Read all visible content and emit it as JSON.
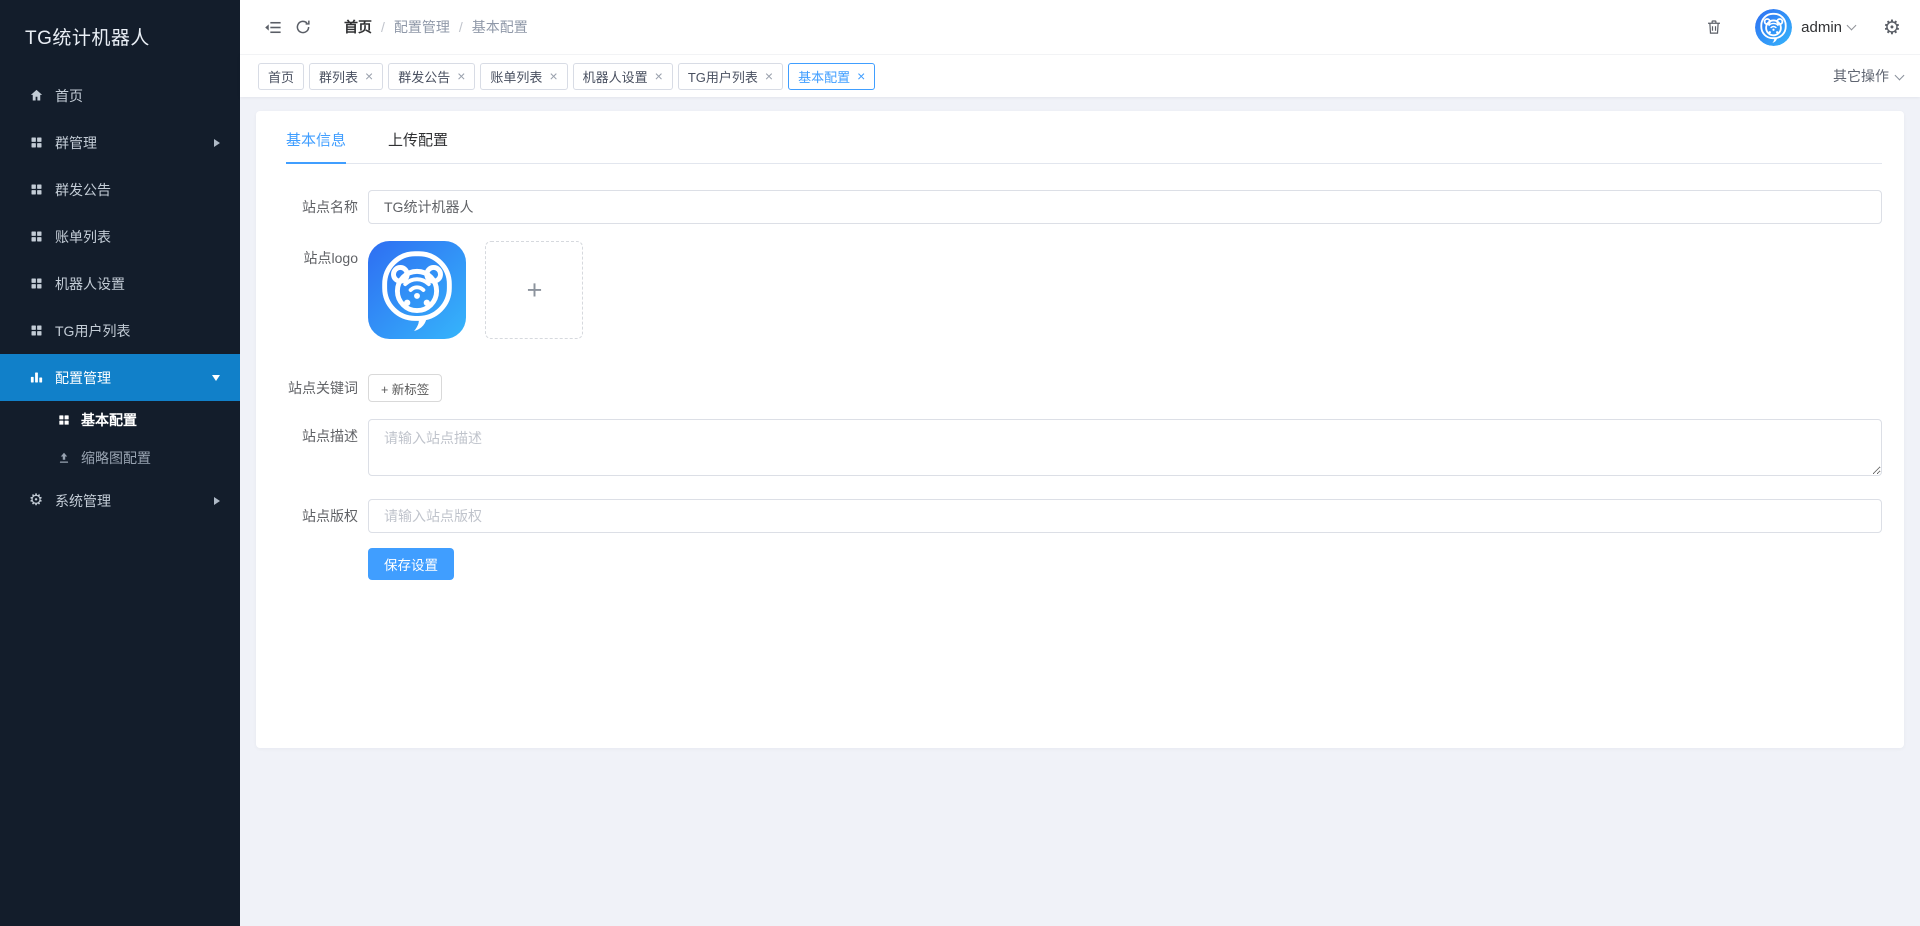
{
  "app": {
    "title": "TG统计机器人"
  },
  "sidebar": {
    "items": [
      {
        "label": "首页"
      },
      {
        "label": "群管理"
      },
      {
        "label": "群发公告"
      },
      {
        "label": "账单列表"
      },
      {
        "label": "机器人设置"
      },
      {
        "label": "TG用户列表"
      },
      {
        "label": "配置管理",
        "children": [
          {
            "label": "基本配置"
          },
          {
            "label": "缩略图配置"
          }
        ]
      },
      {
        "label": "系统管理"
      }
    ]
  },
  "header": {
    "breadcrumb": [
      "首页",
      "配置管理",
      "基本配置"
    ],
    "user": "admin"
  },
  "tags": {
    "items": [
      {
        "label": "首页"
      },
      {
        "label": "群列表"
      },
      {
        "label": "群发公告"
      },
      {
        "label": "账单列表"
      },
      {
        "label": "机器人设置"
      },
      {
        "label": "TG用户列表"
      },
      {
        "label": "基本配置"
      }
    ],
    "more_label": "其它操作"
  },
  "content": {
    "tabs": [
      {
        "label": "基本信息"
      },
      {
        "label": "上传配置"
      }
    ],
    "form": {
      "site_name": {
        "label": "站点名称",
        "value": "TG统计机器人"
      },
      "site_logo": {
        "label": "站点logo"
      },
      "site_keywords": {
        "label": "站点关键词",
        "add_label": "+ 新标签"
      },
      "site_desc": {
        "label": "站点描述",
        "placeholder": "请输入站点描述"
      },
      "site_copyright": {
        "label": "站点版权",
        "placeholder": "请输入站点版权"
      },
      "save_label": "保存设置"
    }
  },
  "icons": {
    "close": "×",
    "plus": "+",
    "separator": "/",
    "gear": "⚙"
  },
  "colors": {
    "accent": "#409eff",
    "sidebar_bg": "#131d2b",
    "sidebar_active": "#1180c9",
    "page_bg": "#f0f2f8"
  }
}
